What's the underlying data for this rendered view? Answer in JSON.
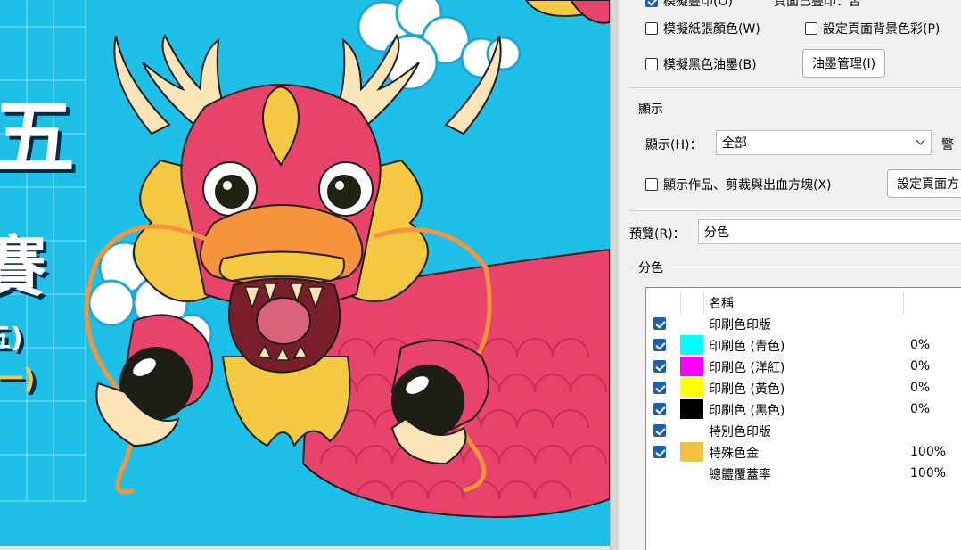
{
  "artwork": {
    "glyphs": [
      "五",
      "賽",
      "五)",
      "(一)"
    ]
  },
  "dialog": {
    "top_partial_left": "模擬疊印(O)",
    "top_partial_right": "頁面已疊印：否",
    "simulate_paper": "模擬紙張顏色(W)",
    "page_bg_color": "設定頁面背景色彩(P)",
    "simulate_black": "模擬黑色油墨(B)",
    "ink_manager": "油墨管理(I)",
    "display_group_title": "顯示",
    "display_label": "顯示(H)：",
    "display_value": "全部",
    "warning_partial": "警",
    "show_art_trim": "顯示作品、剪裁與出血方塊(X)",
    "set_page_partial": "設定頁面方",
    "preview_label": "預覽(R)：",
    "preview_value": "分色",
    "sep_group_title": "分色",
    "table_header_name": "名稱",
    "rows": [
      {
        "name": "印刷色印版",
        "pct": "",
        "checked": true,
        "swatch": ""
      },
      {
        "name": "印刷色 (青色)",
        "pct": "0%",
        "checked": true,
        "swatch": "#00ffff"
      },
      {
        "name": "印刷色 (洋紅)",
        "pct": "0%",
        "checked": true,
        "swatch": "#ff00ff"
      },
      {
        "name": "印刷色 (黃色)",
        "pct": "0%",
        "checked": true,
        "swatch": "#ffff00"
      },
      {
        "name": "印刷色 (黑色)",
        "pct": "0%",
        "checked": true,
        "swatch": "#000000"
      },
      {
        "name": "特別色印版",
        "pct": "",
        "checked": true,
        "swatch": ""
      },
      {
        "name": "特殊色金",
        "pct": "100%",
        "checked": true,
        "swatch": "#f2c144"
      },
      {
        "name": "總體覆蓋率",
        "pct": "100%",
        "checked": false,
        "swatch": ""
      }
    ]
  }
}
